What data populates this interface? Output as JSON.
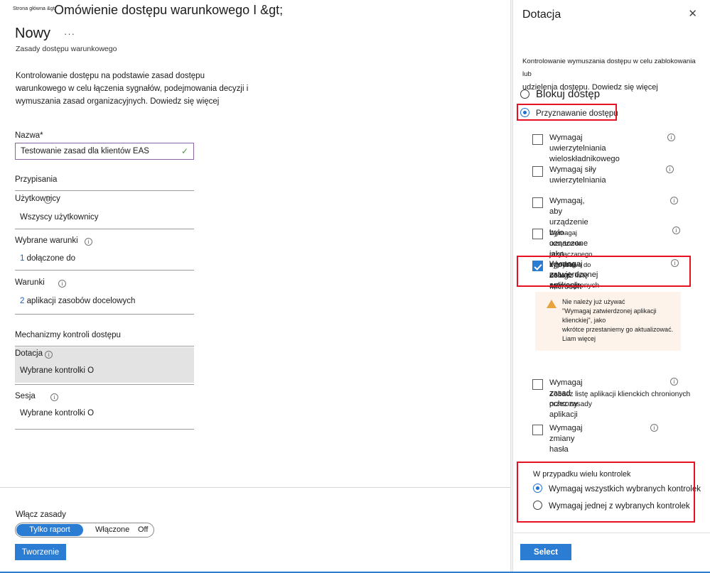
{
  "left": {
    "breadcrumb": "Strona główna &gt;",
    "page_title": "Omówienie dostępu warunkowego I &gt;",
    "heading": "Nowy",
    "ellipsis": "···",
    "subtitle": "Zasady dostępu warunkowego",
    "intro": "Kontrolowanie dostępu na podstawie zasad dostępu warunkowego w celu łączenia sygnałów, podejmowania decyzji i wymuszania zasad organizacyjnych. Dowiedz się więcej",
    "name_label": "Nazwa*",
    "name_value": "Testowanie zasad dla klientów EAS",
    "name_valid_icon": "checkmark-icon",
    "assignments_header": "Przypisania",
    "users_label": "Użytkownicy",
    "users_value": "Wszyscy użytkownicy",
    "selected_conditions_label": "Wybrane warunki",
    "selected_conditions_count": "1",
    "selected_conditions_value": "dołączone do",
    "conditions_label": "Warunki",
    "conditions_count": "2",
    "conditions_value": "aplikacji zasobów docelowych",
    "access_controls_header": "Mechanizmy kontroli dostępu",
    "grant_label": "Dotacja",
    "grant_value": "Wybrane kontrolki O",
    "session_label": "Sesja",
    "session_value": "Wybrane kontrolki O",
    "enable_label": "Włącz zasady",
    "toggle_report_only": "Tylko raport",
    "toggle_on": "Włączone",
    "toggle_off": "Off",
    "create_button": "Tworzenie"
  },
  "right": {
    "title": "Dotacja",
    "close_icon": "close-icon",
    "description_line1": "Kontrolowanie wymuszania dostępu w celu zablokowania lub",
    "description_line2": "udzielenia dostępu. Dowiedz się więcej",
    "block_access": "Blokuj dostęp",
    "grant_access": "Przyznawanie dostępu",
    "checks": [
      {
        "label_line1": "Wymagaj uwierzytelniania",
        "label_line2": "wieloskładnikowego",
        "checked": false,
        "info": true
      },
      {
        "label_line1": "Wymagaj siły",
        "label_line2": "uwierzytelniania",
        "checked": false,
        "info": true
      },
      {
        "label_line1": "Wymagaj, aby urządzenie było oznaczone",
        "label_line2": "jako zgodne",
        "checked": false,
        "info": true
      },
      {
        "label_line1": "Wymagaj urządzenia przyłączanego hybrydowo do",
        "label_line2": "usługi Microsoft Entrap",
        "checked": false,
        "info": true
      },
      {
        "label_line1": "Wymagaj zatwierdzonej aplikacji klienckiej",
        "sub": "Zobacz listę zatwierdzonych aplikacji klienckich",
        "checked": true,
        "info": true
      },
      {
        "label_line1": "Wymagaj zasad ochrony aplikacji",
        "sub": "Zobacz listę aplikacji klienckich chronionych przez zasady",
        "checked": false,
        "info": true
      },
      {
        "label_line1": "Wymagaj zmiany hasła",
        "checked": false,
        "info": true
      }
    ],
    "warning": {
      "icon": "warning-icon",
      "line1": "Nie należy już używać",
      "line2": "\"Wymagaj zatwierdzonej aplikacji klienckiej\", jako",
      "line3": "wkrótce przestaniemy go aktualizować.",
      "line4": "Liam więcej"
    },
    "multi_header": "W przypadku wielu kontrolek",
    "multi_all": "Wymagaj wszystkich wybranych kontrolek",
    "multi_one": "Wymagaj jednej z wybranych kontrolek",
    "select_button": "Select"
  },
  "colors": {
    "accent": "#2b7cd3",
    "highlight_outline": "#e81123",
    "warning_bg": "#fdf3ea",
    "warning_icon": "#e8a33d"
  }
}
